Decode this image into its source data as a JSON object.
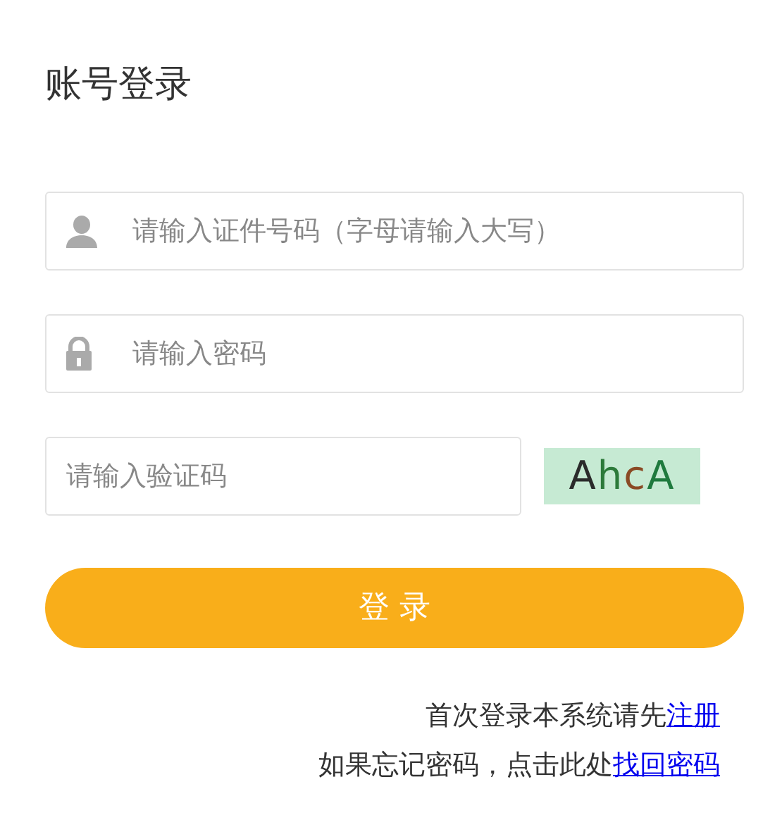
{
  "title": "账号登录",
  "fields": [
    {
      "kind": "user",
      "placeholder": "请输入证件号码（字母请输入大写）"
    },
    {
      "kind": "lock",
      "placeholder": "请输入密码"
    }
  ],
  "captcha": {
    "placeholder": "请输入验证码",
    "code": "AhcA"
  },
  "login_button": "登 录",
  "notes": [
    {
      "text": "首次登录本系统请先",
      "link": "注册"
    },
    {
      "text": "如果忘记密码，点击此处",
      "link": "找回密码"
    }
  ]
}
